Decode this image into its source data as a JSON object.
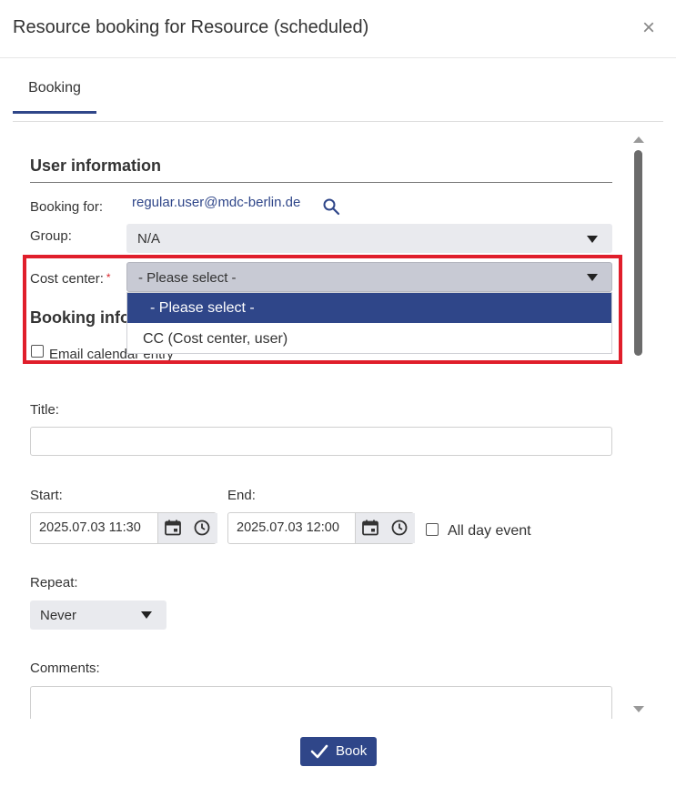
{
  "dialog": {
    "title": "Resource booking for Resource (scheduled)",
    "close_label": "×"
  },
  "tabs": [
    {
      "label": "Booking",
      "active": true
    }
  ],
  "user_info": {
    "section_title": "User information",
    "booking_for_label": "Booking for:",
    "booking_for_value": "regular.user@mdc-berlin.de",
    "group_label": "Group:",
    "group_value": "N/A",
    "cost_center_label": "Cost center:",
    "cost_center_required_mark": "*",
    "cost_center_value": "- Please select -",
    "cost_center_options": [
      "- Please select -",
      "CC (Cost center, user)"
    ]
  },
  "booking_info": {
    "section_title": "Booking info",
    "email_calendar_label": "Email calendar entry",
    "title_label": "Title:",
    "title_value": "",
    "start_label": "Start:",
    "start_value": "2025.07.03 11:30",
    "end_label": "End:",
    "end_value": "2025.07.03 12:00",
    "all_day_label": "All day event",
    "repeat_label": "Repeat:",
    "repeat_value": "Never",
    "comments_label": "Comments:",
    "comments_value": ""
  },
  "footer": {
    "book_label": "Book"
  },
  "colors": {
    "accent": "#2f4689",
    "highlight": "#e01e2b",
    "select_bg": "#e9eaee"
  }
}
